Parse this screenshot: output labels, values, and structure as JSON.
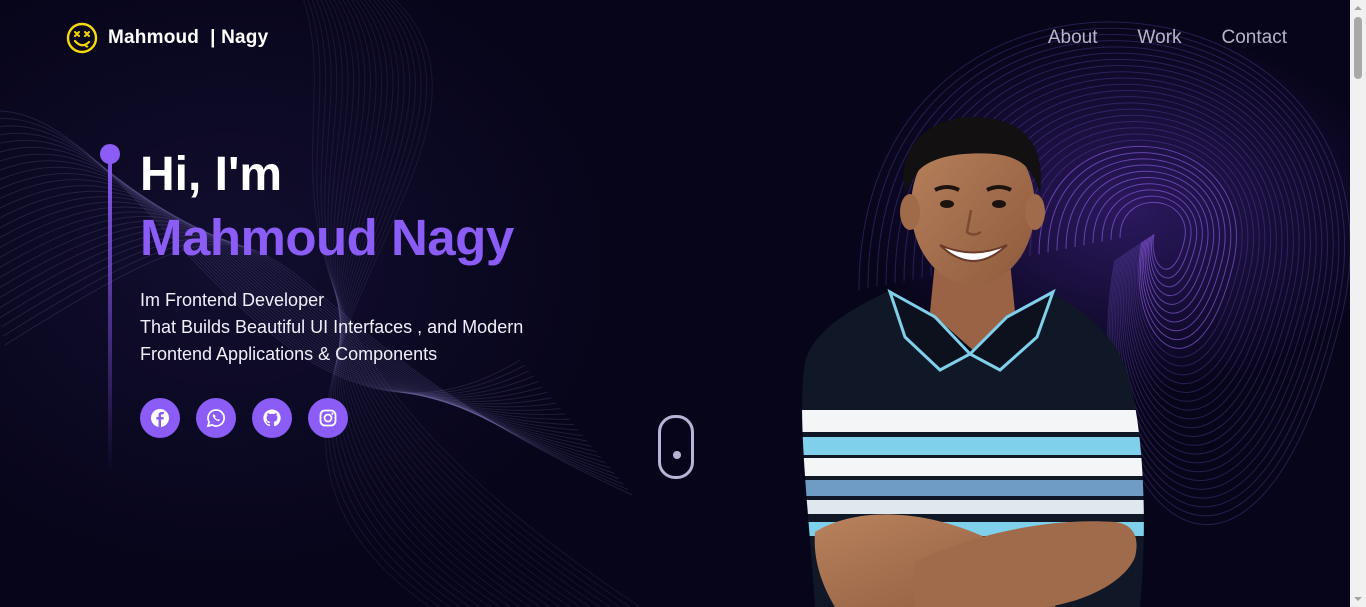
{
  "brand": {
    "name": "Mahmoud",
    "suffix": "| Nagy",
    "icon": "smiley-x-eyes-icon",
    "icon_color": "#f5d90a"
  },
  "nav": {
    "items": [
      {
        "label": "About"
      },
      {
        "label": "Work"
      },
      {
        "label": "Contact"
      }
    ]
  },
  "hero": {
    "greeting": "Hi, I'm",
    "name": "Mahmoud Nagy",
    "description": [
      "Im Frontend Developer",
      "That Builds Beautiful UI Interfaces , and Modern",
      "Frontend Applications & Components"
    ]
  },
  "socials": [
    {
      "icon": "facebook-icon"
    },
    {
      "icon": "whatsapp-icon"
    },
    {
      "icon": "github-icon"
    },
    {
      "icon": "instagram-icon"
    }
  ],
  "colors": {
    "accent": "#8b5cf6",
    "background": "#07051a",
    "nav_text": "#b7b3c9"
  }
}
